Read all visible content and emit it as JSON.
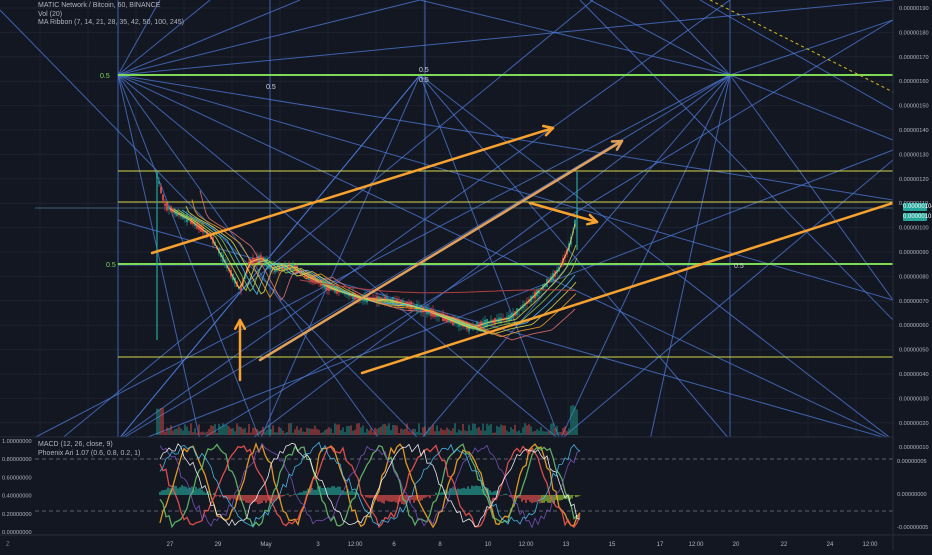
{
  "chart": {
    "symbol_line": "MATIC Network / Bitcoin, 60, BINANCE",
    "indicators_main": [
      "Vol (20)",
      "MA Ribbon (7, 14, 21, 28, 35, 42, 50, 100, 245)"
    ],
    "indicators_sub": [
      "MACD (12, 26, close, 9)",
      "Phoenix Ari 1.07 (0.6, 0.8, 0.2, 1)"
    ],
    "price_axis": [
      "0.00000190",
      "0.00000180",
      "0.00000170",
      "0.00000160",
      "0.00000150",
      "0.00000140",
      "0.00000130",
      "0.00000120",
      "0.00000110",
      "0.00000100",
      "0.00000090",
      "0.00000080",
      "0.00000070",
      "0.00000060",
      "0.00000050",
      "0.00000040",
      "0.00000030",
      "0.00000020",
      "0.00000010"
    ],
    "last_price_badge": "0.00000104",
    "last_price_badge_2": "0.00000101",
    "macd_axis_right": [
      "0.00000005",
      "0.00000000",
      "-0.00000005"
    ],
    "osc_axis_left": [
      "1.00000000",
      "0.80000000",
      "0.60000000",
      "0.40000000",
      "0.20000000",
      "0.00000000"
    ],
    "time_axis": [
      "27",
      "29",
      "May",
      "3",
      "12:00",
      "6",
      "8",
      "10",
      "12:00",
      "13",
      "15",
      "17",
      "12:00",
      "20",
      "22",
      "24",
      "12:00"
    ],
    "fib_labels": [
      "0.5",
      "0.5",
      "0.5",
      "0.5",
      "0.5",
      "0.5"
    ],
    "colors": {
      "bg": "#131722",
      "up": "#26a69a",
      "down": "#ef5350",
      "gann": "#4f7bd9",
      "level_yellow": "#d4d44a",
      "level_green": "#7ed957",
      "arrow": "#f7a130"
    }
  }
}
